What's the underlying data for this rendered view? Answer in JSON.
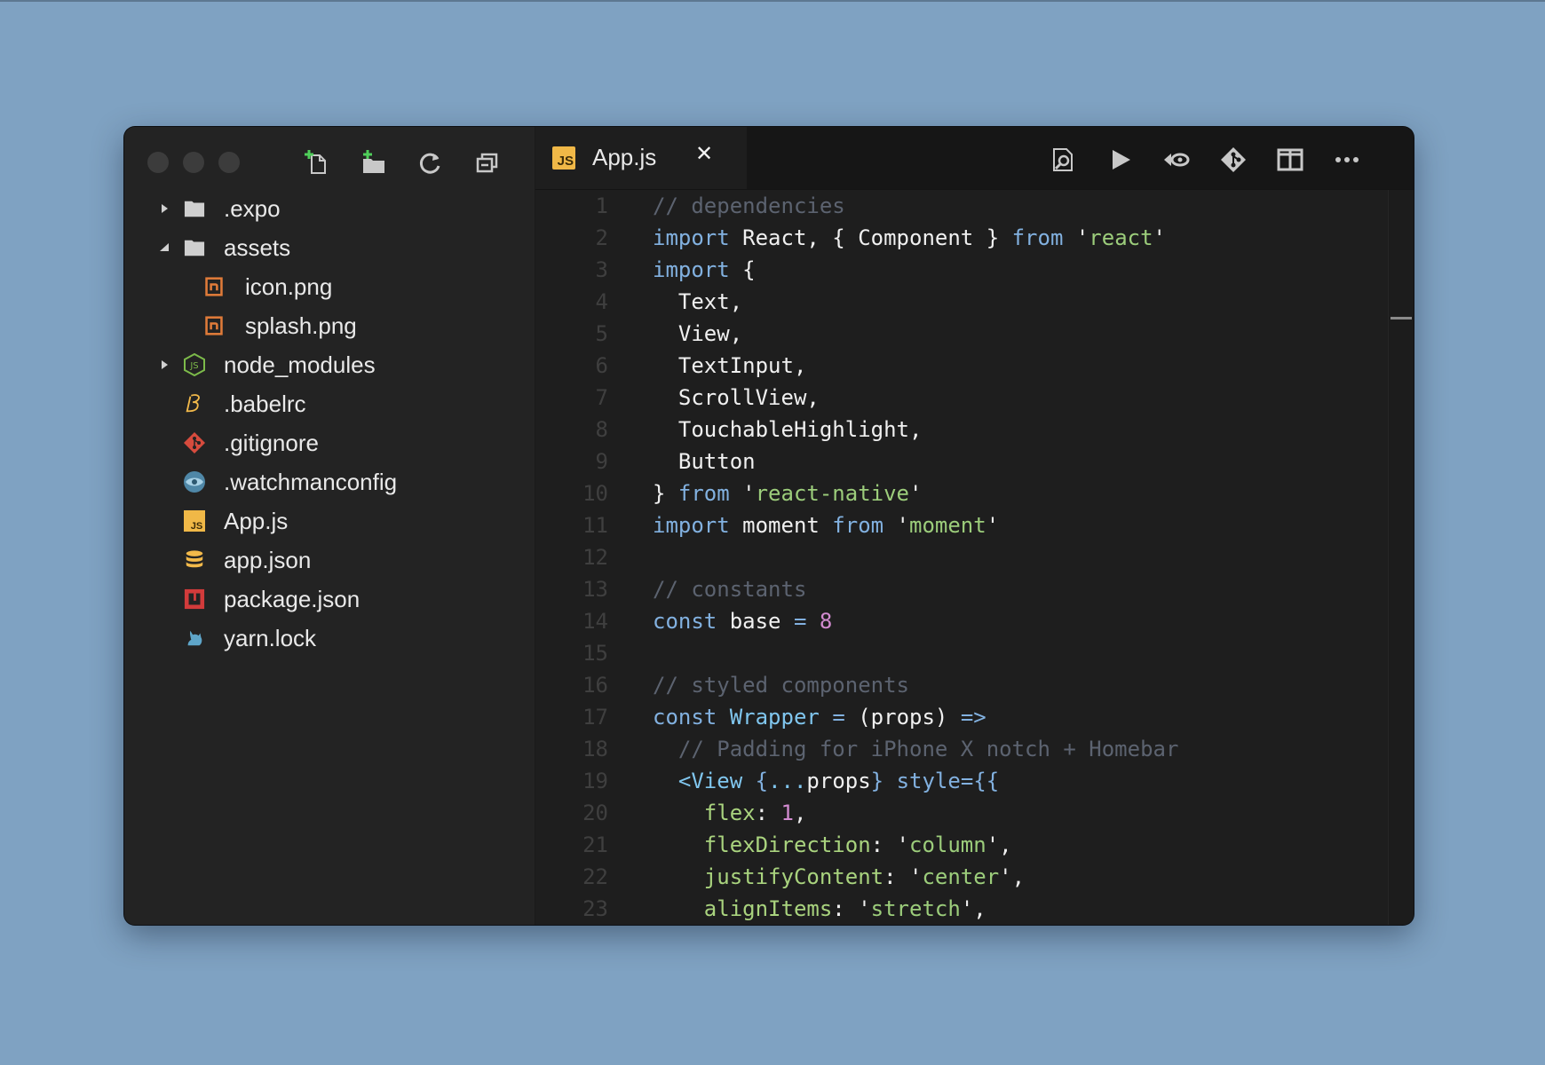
{
  "sidebar": {
    "toolbar": {
      "new_file_icon": "new-file-icon",
      "new_folder_icon": "new-folder-icon",
      "refresh_icon": "refresh-icon",
      "collapse_icon": "collapse-all-icon"
    },
    "tree": [
      {
        "name": ".expo",
        "type": "folder",
        "expanded": false,
        "icon": "folder-icon"
      },
      {
        "name": "assets",
        "type": "folder",
        "expanded": true,
        "icon": "folder-icon"
      },
      {
        "name": "icon.png",
        "type": "file",
        "icon": "image-file-icon"
      },
      {
        "name": "splash.png",
        "type": "file",
        "icon": "image-file-icon"
      },
      {
        "name": "node_modules",
        "type": "folder",
        "expanded": false,
        "icon": "nodejs-icon"
      },
      {
        "name": ".babelrc",
        "type": "file",
        "icon": "babel-icon"
      },
      {
        "name": ".gitignore",
        "type": "file",
        "icon": "git-icon"
      },
      {
        "name": ".watchmanconfig",
        "type": "file",
        "icon": "watchman-icon"
      },
      {
        "name": "App.js",
        "type": "file",
        "icon": "js-icon"
      },
      {
        "name": "app.json",
        "type": "file",
        "icon": "json-database-icon"
      },
      {
        "name": "package.json",
        "type": "file",
        "icon": "npm-icon"
      },
      {
        "name": "yarn.lock",
        "type": "file",
        "icon": "yarn-icon"
      }
    ]
  },
  "editor": {
    "tab": {
      "label": "App.js",
      "icon_text": "JS",
      "close": "✕"
    },
    "toolbar": [
      "find-in-file-icon",
      "run-icon",
      "debug-icon",
      "git-icon",
      "split-view-icon",
      "more-icon"
    ],
    "colors": {
      "comment": "#5c6370",
      "keyword": "#82b1e0",
      "string": "#9ccd7b",
      "number": "#d28bd0",
      "plain": "#f0f0f0",
      "js_badge": "#f0b847"
    },
    "lines": [
      {
        "n": "1",
        "tokens": [
          [
            "cm",
            "// dependencies"
          ]
        ]
      },
      {
        "n": "2",
        "tokens": [
          [
            "kw",
            "import"
          ],
          [
            "pl",
            " React, { Component } "
          ],
          [
            "kw",
            "from"
          ],
          [
            "pl",
            " '"
          ],
          [
            "str",
            "react"
          ],
          [
            "pl",
            "'"
          ]
        ]
      },
      {
        "n": "3",
        "tokens": [
          [
            "kw",
            "import"
          ],
          [
            "pl",
            " {"
          ]
        ]
      },
      {
        "n": "4",
        "tokens": [
          [
            "pl",
            "  Text,"
          ]
        ]
      },
      {
        "n": "5",
        "tokens": [
          [
            "pl",
            "  View,"
          ]
        ]
      },
      {
        "n": "6",
        "tokens": [
          [
            "pl",
            "  TextInput,"
          ]
        ]
      },
      {
        "n": "7",
        "tokens": [
          [
            "pl",
            "  ScrollView,"
          ]
        ]
      },
      {
        "n": "8",
        "tokens": [
          [
            "pl",
            "  TouchableHighlight,"
          ]
        ]
      },
      {
        "n": "9",
        "tokens": [
          [
            "pl",
            "  Button"
          ]
        ]
      },
      {
        "n": "10",
        "tokens": [
          [
            "pl",
            "} "
          ],
          [
            "kw",
            "from"
          ],
          [
            "pl",
            " '"
          ],
          [
            "str",
            "react-native"
          ],
          [
            "pl",
            "'"
          ]
        ]
      },
      {
        "n": "11",
        "tokens": [
          [
            "kw",
            "import"
          ],
          [
            "pl",
            " moment "
          ],
          [
            "kw",
            "from"
          ],
          [
            "pl",
            " '"
          ],
          [
            "str",
            "moment"
          ],
          [
            "pl",
            "'"
          ]
        ]
      },
      {
        "n": "12",
        "tokens": []
      },
      {
        "n": "13",
        "tokens": [
          [
            "cm",
            "// constants"
          ]
        ]
      },
      {
        "n": "14",
        "tokens": [
          [
            "kw",
            "const"
          ],
          [
            "pl",
            " base "
          ],
          [
            "kw",
            "="
          ],
          [
            "pl",
            " "
          ],
          [
            "num",
            "8"
          ]
        ]
      },
      {
        "n": "15",
        "tokens": []
      },
      {
        "n": "16",
        "tokens": [
          [
            "cm",
            "// styled components"
          ]
        ]
      },
      {
        "n": "17",
        "tokens": [
          [
            "kw",
            "const"
          ],
          [
            "pl",
            " "
          ],
          [
            "tag",
            "Wrapper"
          ],
          [
            "pl",
            " "
          ],
          [
            "kw",
            "="
          ],
          [
            "pl",
            " (props) "
          ],
          [
            "kw",
            "=>"
          ]
        ]
      },
      {
        "n": "18",
        "tokens": [
          [
            "pl",
            "  "
          ],
          [
            "cm",
            "// Padding for iPhone X notch + Homebar"
          ]
        ]
      },
      {
        "n": "19",
        "tokens": [
          [
            "pl",
            "  "
          ],
          [
            "tag",
            "<View"
          ],
          [
            "pl",
            " "
          ],
          [
            "kw",
            "{"
          ],
          [
            "tag",
            "..."
          ],
          [
            "pl",
            "props"
          ],
          [
            "kw",
            "}"
          ],
          [
            "pl",
            " "
          ],
          [
            "kw",
            "style={{"
          ]
        ]
      },
      {
        "n": "20",
        "tokens": [
          [
            "pl",
            "    "
          ],
          [
            "prop",
            "flex"
          ],
          [
            "pl",
            ": "
          ],
          [
            "num",
            "1"
          ],
          [
            "pl",
            ","
          ]
        ]
      },
      {
        "n": "21",
        "tokens": [
          [
            "pl",
            "    "
          ],
          [
            "prop",
            "flexDirection"
          ],
          [
            "pl",
            ": '"
          ],
          [
            "str",
            "column"
          ],
          [
            "pl",
            "',"
          ]
        ]
      },
      {
        "n": "22",
        "tokens": [
          [
            "pl",
            "    "
          ],
          [
            "prop",
            "justifyContent"
          ],
          [
            "pl",
            ": '"
          ],
          [
            "str",
            "center"
          ],
          [
            "pl",
            "',"
          ]
        ]
      },
      {
        "n": "23",
        "tokens": [
          [
            "pl",
            "    "
          ],
          [
            "prop",
            "alignItems"
          ],
          [
            "pl",
            ": '"
          ],
          [
            "str",
            "stretch"
          ],
          [
            "pl",
            "',"
          ]
        ]
      }
    ]
  }
}
